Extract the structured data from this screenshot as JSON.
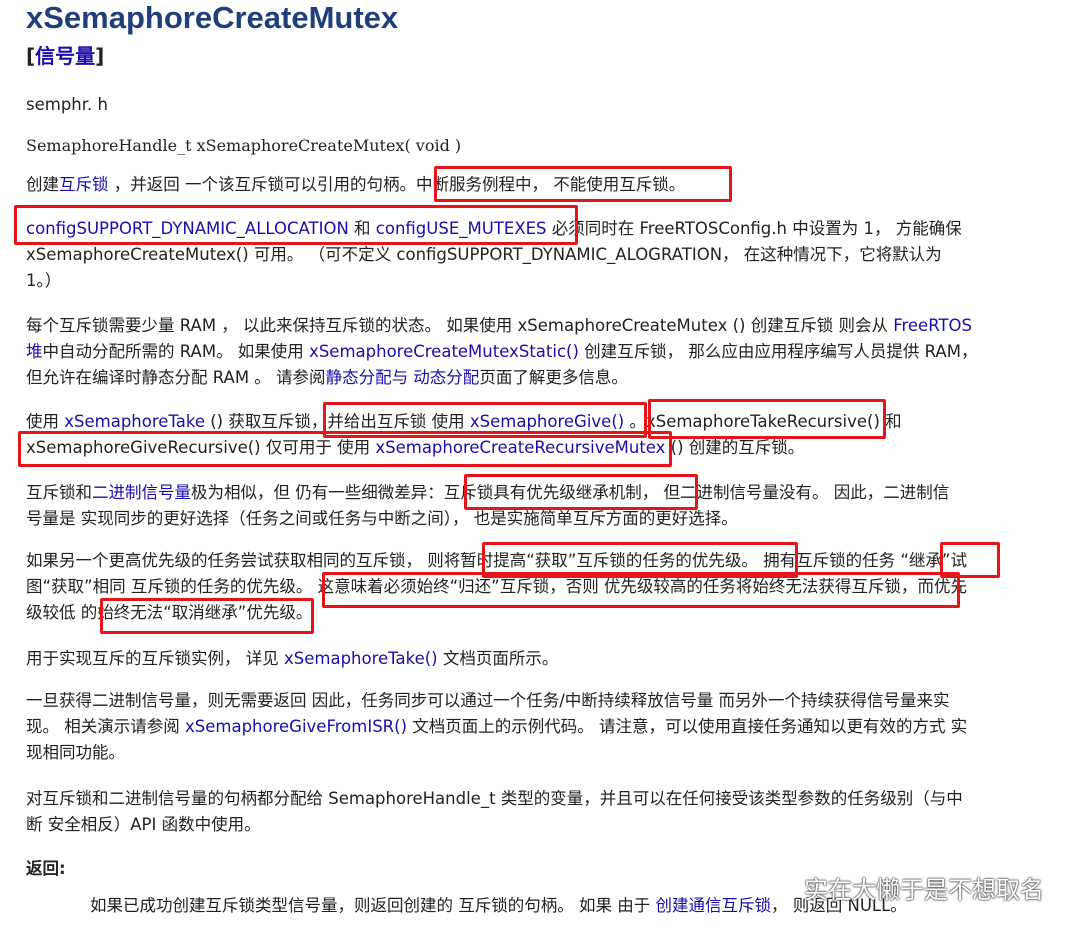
{
  "title": "xSemaphoreCreateMutex",
  "category": {
    "open": "[",
    "label": "信号量",
    "close": "]"
  },
  "header_file": "semphr. h",
  "signature": "SemaphoreHandle_t xSemaphoreCreateMutex( void )",
  "p1": {
    "a": "创建",
    "link1": "互斥锁",
    "b": " ，并返回 一个该互斥锁可以引用的句柄。",
    "c": "中断服务例程中， 不能使用互斥锁。"
  },
  "p2": {
    "link1": "configSUPPORT_DYNAMIC_ALLOCATION",
    "a": " 和 ",
    "link2": "configUSE_MUTEXES",
    "b": " 必须同时在 FreeRTOSConfig.h 中设置为 1， 方能确保",
    "line2": "xSemaphoreCreateMutex() 可用。 （可不定义 configSUPPORT_DYNAMIC_ALOGRATION， 在这种情况下，它将默认为",
    "line3": "1。）"
  },
  "p3": {
    "a": "每个互斥锁需要少量 RAM ， 以此来保持互斥锁的状态。 如果使用 xSemaphoreCreateMutex () 创建互斥锁 则会从 ",
    "link1": "FreeRTOS",
    "link2": "堆",
    "b": "中自动分配所需的 RAM。 如果使用 ",
    "link3": "xSemaphoreCreateMutexStatic()",
    "c": " 创建互斥锁， 那么应由应用程序编写人员提供 RAM，",
    "d": "但允许在编译时静态分配 RAM 。 请参阅",
    "link4": "静态分配与 动态分配",
    "e": "页面了解更多信息。"
  },
  "p4": {
    "a": "使用 ",
    "link1": "xSemaphoreTake",
    "b": " () 获取互斥锁，",
    "c": "并给出互斥锁 使用 ",
    "link2": "xSemaphoreGive()",
    "d": " 。",
    "e": "xSemaphoreTakeRecursive()",
    "f": " 和",
    "g": "xSemaphoreGiveRecursive() 仅可用于 使用 ",
    "link3": "xSemaphoreCreateRecursiveMutex",
    "h": " ()",
    "i": " 创建的互斥锁。"
  },
  "p5": {
    "a": "互斥锁和",
    "link1": "二进制信号量",
    "b": "极为相似，但 仍有一些细微差异：",
    "c": "互斥锁具有优先级继承机制，",
    "d": " 但二进制信号量没有。 因此，二进制信",
    "line2": "号量是 实现同步的更好选择（任务之间或任务与中断之间）， 也是实施简单互斥方面的更好选择。"
  },
  "p6": {
    "a": "如果另一个更高优先级的任务尝试获取相同的互斥锁， 则将",
    "b": "暂时提高“获取”互斥锁的任务的优先级。",
    "c": " 拥有互斥锁的任务 ",
    "d": "“继承”",
    "e": "试",
    "f": "图“获取”相同 互斥锁的任务的优先级。 ",
    "g": "这意味着必须始终“归还”互斥锁，否则 优先级较高的任务将始终无法获得互斥锁，",
    "h": "而优先",
    "i": "级较低 的",
    "j": "始终无法“取消继承”优先级",
    "k": "。"
  },
  "p7": {
    "a": "用于实现互斥的互斥锁实例， 详见 ",
    "link1": "xSemaphoreTake()",
    "b": " 文档页面所示。"
  },
  "p8": {
    "a": "一旦获得二进制信号量，则无需要返回 因此，任务同步可以通过一个任务/中断持续释放信号量 而另外一个持续获得信号量来实",
    "b": "现。 相关演示请参阅 ",
    "link1": "xSemaphoreGiveFromISR()",
    "c": " 文档页面上的示例代码。 请注意，可以使用直接任务通知以更有效的方式 实",
    "d": "现相同功能。"
  },
  "p9": {
    "a": "对互斥锁和二进制信号量的句柄都分配给 SemaphoreHandle_t 类型的变量，并且可以在任何接受该类型参数的任务级别（与中",
    "b": "断 安全相反）API 函数中使用。"
  },
  "returns_heading": "返回:",
  "returns": {
    "a": "如果已成功创建互斥锁类型信号量，则返回创建的 互斥锁的句柄。 如果 由于 ",
    "link1": "创建通信互斥锁",
    "b": "， 则返回 NULL。"
  },
  "watermark": "实在大懒于是不想取名",
  "colors": {
    "link": "#1a0dab",
    "title": "#1f3f7a",
    "highlight_box": "#e8141b",
    "text": "#222222"
  }
}
